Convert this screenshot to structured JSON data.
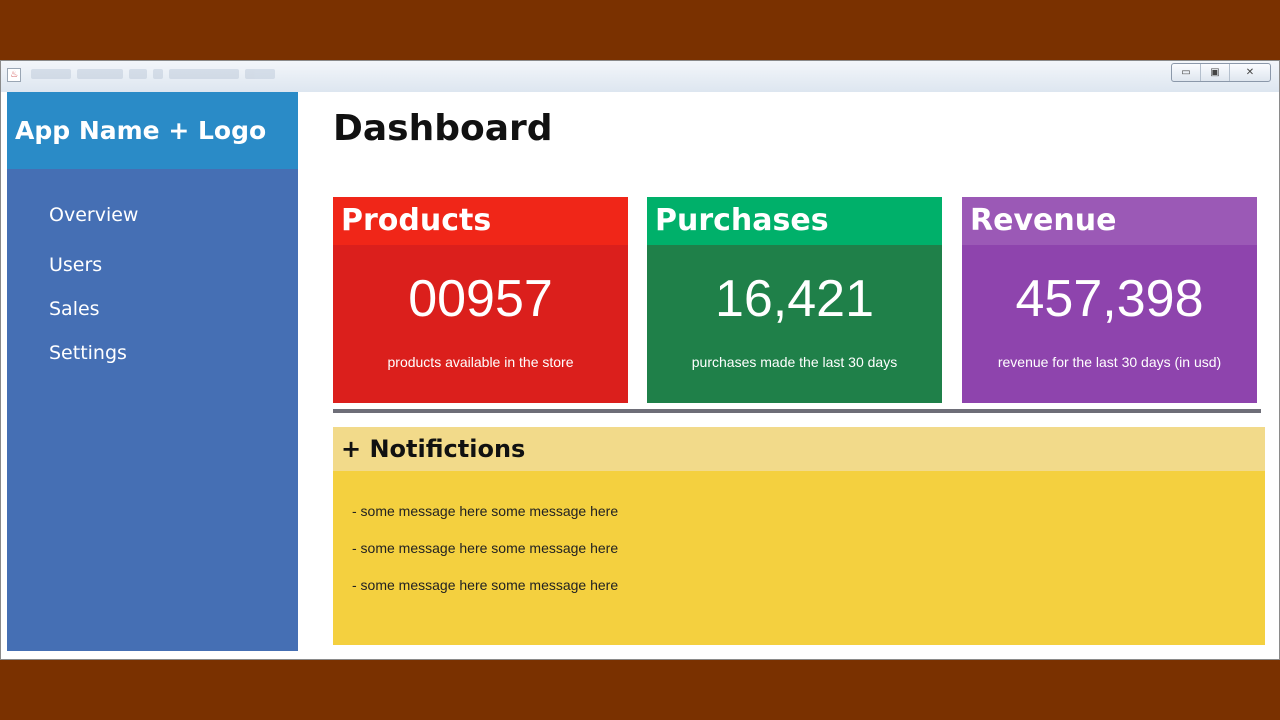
{
  "window": {
    "controls": {
      "minimize": "▭",
      "maximize": "▣",
      "close": "✕"
    }
  },
  "sidebar": {
    "brand": "App Name + Logo",
    "items": [
      {
        "label": "Overview"
      },
      {
        "label": "Users"
      },
      {
        "label": "Sales"
      },
      {
        "label": "Settings"
      }
    ]
  },
  "main": {
    "title": "Dashboard",
    "cards": [
      {
        "title": "Products",
        "value": "00957",
        "caption": "products available in the store",
        "head_color": "#f02618",
        "body_color": "#db1f1c"
      },
      {
        "title": "Purchases",
        "value": "16,421",
        "caption": "purchases made the last 30 days",
        "head_color": "#00b06a",
        "body_color": "#1f8049"
      },
      {
        "title": "Revenue",
        "value": "457,398",
        "caption": "revenue for the last 30 days (in usd)",
        "head_color": "#9b59b6",
        "body_color": "#8e44ad"
      }
    ],
    "notifications": {
      "title": "+ Notifictions",
      "messages": [
        "- some message here some message here",
        "- some message here some message here",
        "- some message here some message here"
      ]
    }
  }
}
